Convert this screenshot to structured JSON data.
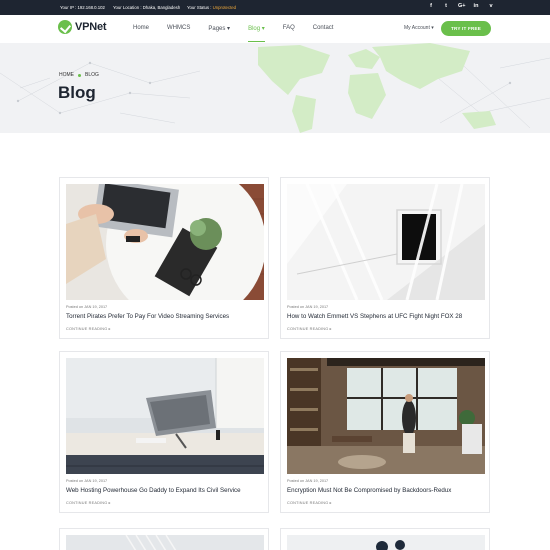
{
  "topbar": {
    "ip": "Your IP : 192.168.0.102",
    "location": "Your Location : Dhaka, Bangladesh",
    "status_label": "Your Status :",
    "status_value": "Unprotected",
    "social": [
      {
        "icon": "facebook-icon",
        "glyph": "f"
      },
      {
        "icon": "twitter-icon",
        "glyph": "t"
      },
      {
        "icon": "google-plus-icon",
        "glyph": "G+"
      },
      {
        "icon": "linkedin-icon",
        "glyph": "in"
      },
      {
        "icon": "vimeo-icon",
        "glyph": "v"
      }
    ]
  },
  "header": {
    "logo_text": "VPNet",
    "nav": {
      "home": "Home",
      "whmcs": "WHMCS",
      "pages": "Pages ▾",
      "blog": "Blog ▾",
      "faq": "FAQ",
      "contact": "Contact"
    },
    "account": "My Account ▾",
    "cta": "TRY IT FREE"
  },
  "colors": {
    "accent": "#6abf4b",
    "dark": "#1e2531",
    "status": "#f0a93a"
  },
  "hero": {
    "breadcrumb": [
      "HOME",
      "BLOG"
    ],
    "title": "Blog"
  },
  "posts": [
    {
      "date": "Posted on JAN 19, 2017",
      "title": "Torrent Pirates Prefer To Pay For Video Streaming Services",
      "more": "CONTINUE READING ▸"
    },
    {
      "date": "Posted on JAN 19, 2017",
      "title": "How to Watch Emmett VS Stephens at UFC Fight Night FOX 28",
      "more": "CONTINUE READING ▸"
    },
    {
      "date": "Posted on JAN 19, 2017",
      "title": "Web Hosting Powerhouse Go Daddy to Expand Its Civil Service",
      "more": "CONTINUE READING ▸"
    },
    {
      "date": "Posted on JAN 19, 2017",
      "title": "Encryption Must Not Be Compromised by Backdoors-Redux",
      "more": "CONTINUE READING ▸"
    }
  ]
}
